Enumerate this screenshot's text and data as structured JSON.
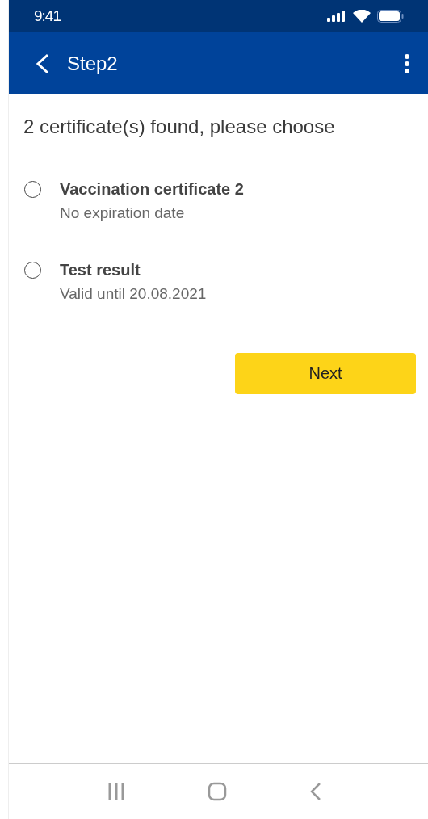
{
  "status_bar": {
    "time": "9:41"
  },
  "app_bar": {
    "title": "Step2"
  },
  "heading": "2 certificate(s) found, please choose",
  "options": [
    {
      "title": "Vaccination certificate 2",
      "subtitle": "No expiration date",
      "selected": false
    },
    {
      "title": "Test result",
      "subtitle": "Valid until 20.08.2021",
      "selected": false
    }
  ],
  "next_button": {
    "label": "Next"
  }
}
